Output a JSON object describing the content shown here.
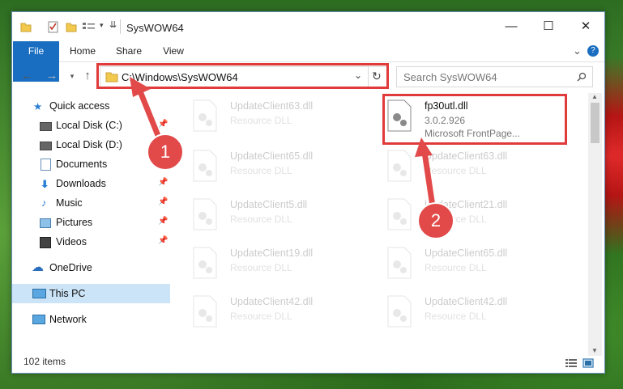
{
  "window": {
    "title": "SysWOW64",
    "minimize": "—",
    "maximize": "☐",
    "close": "✕"
  },
  "ribbon": {
    "tabs": [
      "File",
      "Home",
      "Share",
      "View"
    ],
    "collapse": "⌄",
    "help": "?"
  },
  "address": {
    "path": "C:\\Windows\\SysWOW64",
    "search_placeholder": "Search SysWOW64"
  },
  "sidebar": {
    "items": [
      {
        "label": "Quick access",
        "pinned": false
      },
      {
        "label": "Local Disk (C:)",
        "pinned": true
      },
      {
        "label": "Local Disk (D:)",
        "pinned": false
      },
      {
        "label": "Documents",
        "pinned": true
      },
      {
        "label": "Downloads",
        "pinned": true
      },
      {
        "label": "Music",
        "pinned": true
      },
      {
        "label": "Pictures",
        "pinned": true
      },
      {
        "label": "Videos",
        "pinned": true
      },
      {
        "label": "OneDrive",
        "pinned": false
      },
      {
        "label": "This PC",
        "pinned": false
      },
      {
        "label": "Network",
        "pinned": false
      }
    ]
  },
  "files": {
    "highlighted": {
      "name": "fp30utl.dll",
      "version": "3.0.2.926",
      "description": "Microsoft FrontPage..."
    },
    "left_column": [
      {
        "name": "UpdateClient63.dll",
        "type": "Resource DLL"
      },
      {
        "name": "UpdateClient65.dll",
        "type": "Resource DLL"
      },
      {
        "name": "UpdateClient5.dll",
        "type": "Resource DLL"
      },
      {
        "name": "UpdateClient19.dll",
        "type": "Resource DLL"
      },
      {
        "name": "UpdateClient42.dll",
        "type": "Resource DLL"
      }
    ],
    "right_column": [
      {
        "name": "UpdateClient63.dll",
        "type": "Resource DLL"
      },
      {
        "name": "UpdateClient21.dll",
        "type": "Resource DLL"
      },
      {
        "name": "UpdateClient65.dll",
        "type": "Resource DLL"
      },
      {
        "name": "UpdateClient42.dll",
        "type": "Resource DLL"
      }
    ]
  },
  "status": {
    "item_count": "102 items"
  },
  "annotations": {
    "step1": "1",
    "step2": "2"
  },
  "colors": {
    "accent": "#1a6ec1",
    "highlight": "#e03a3a"
  }
}
